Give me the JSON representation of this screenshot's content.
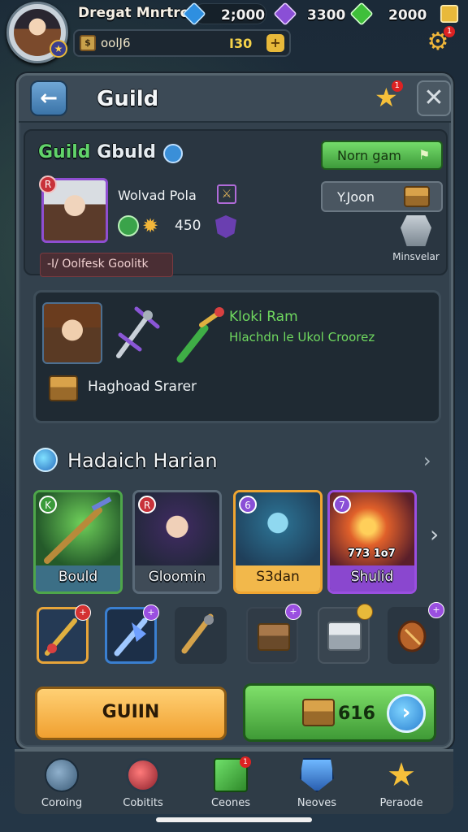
{
  "player": {
    "name": "Dregat Mnrtrok",
    "avatar_icon": "hero-avatar-icon",
    "rank_icon": "rank-shield-icon"
  },
  "resources": [
    {
      "icon": "blue-gem-icon",
      "value": "2;000",
      "color": "#2e8fe0"
    },
    {
      "icon": "purple-crystal-icon",
      "value": "3300",
      "color": "#8a4fd6"
    },
    {
      "icon": "green-gem-icon",
      "value": "2000",
      "color": "#3fbf3a"
    },
    {
      "icon": "gold-gem-icon",
      "value": "",
      "color": "#e8b93a"
    }
  ],
  "subbar": {
    "label": "oolJ6",
    "number": "I30"
  },
  "settings_badge": "1",
  "header": {
    "title": "Guild",
    "star_badge": "1"
  },
  "guild": {
    "title_part1": "Guild",
    "title_part2": "Gbuld",
    "join_button": "Norn gam",
    "secondary_button": "Y.Joon",
    "leader_badge": "R",
    "leader_name": "Wolvad Pola",
    "power_value": "450",
    "motto": "-I/ Oolfesk Goolitk",
    "side_item_label": "Minsvelar"
  },
  "quest": {
    "title": "Kloki Ram",
    "description": "Hlachdn le Ukol Croorez",
    "reward_label": "Haghoad Srarer"
  },
  "heroes_section": {
    "title": "Hadaich Harian"
  },
  "hero_cards": [
    {
      "name": "Bould",
      "badge": "K",
      "border": "#4ea64a",
      "name_bg": "#3c6f86",
      "art": "green-weapon"
    },
    {
      "name": "Gloomin",
      "badge": "R",
      "border": "#5a6a78",
      "name_bg": "#3f4b57",
      "art": "dark-hero"
    },
    {
      "name": "S3dan",
      "badge": "6",
      "border": "#f0a531",
      "name_bg": "#f2b84b",
      "art": "ice-knight"
    },
    {
      "name": "Shulid",
      "badge": "7",
      "border": "#9a4fe0",
      "name_bg": "#8a47cf",
      "art": "fire-hero",
      "overlay": "773 1o7"
    }
  ],
  "items": [
    {
      "icon": "sword-item-icon",
      "badge": "+",
      "badge_color": "#d43232",
      "frame": "#e8a53a",
      "bg": "#253a55"
    },
    {
      "icon": "crystal-blade-icon",
      "badge": "+",
      "badge_color": "#9a4fe0",
      "frame": "#3a7fd0",
      "bg": "#1c2f48"
    },
    {
      "icon": "dagger-item-icon",
      "badge": "",
      "badge_color": "",
      "frame": "#2a3641",
      "bg": "#2a3641"
    },
    {
      "icon": "wooden-chest-icon",
      "badge": "+",
      "badge_color": "#9a4fe0",
      "frame": "#3a4652",
      "bg": "#303b46"
    },
    {
      "icon": "silver-chest-icon",
      "badge": "",
      "badge_color": "#e8b93a",
      "frame": "#4a5661",
      "bg": "#394550"
    },
    {
      "icon": "amulet-item-icon",
      "badge": "+",
      "badge_color": "#9a4fe0",
      "frame": "#2a3641",
      "bg": "#2a3641"
    }
  ],
  "actions": {
    "left_button": "GUIIN",
    "right_value": "616"
  },
  "nav": [
    {
      "label": "Coroing",
      "icon": "shield-sword-icon"
    },
    {
      "label": "Cobitits",
      "icon": "red-orb-icon"
    },
    {
      "label": "Ceones",
      "icon": "green-cube-icon",
      "badge": "1"
    },
    {
      "label": "Neoves",
      "icon": "blue-armor-icon"
    },
    {
      "label": "Peraode",
      "icon": "star-icon"
    }
  ]
}
